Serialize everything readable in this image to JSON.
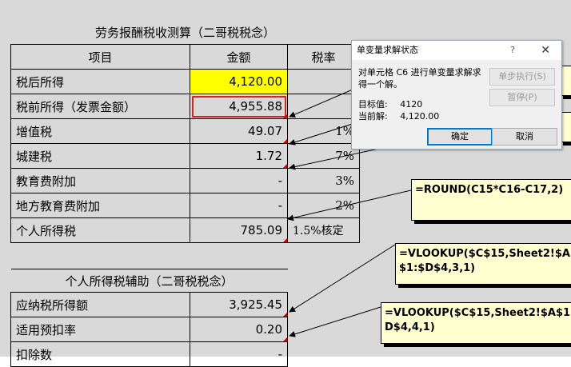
{
  "table1": {
    "title": "劳务报酬税收测算（二哥税税念）",
    "headers": {
      "item": "项目",
      "amount": "金额",
      "rate": "税率"
    },
    "rows": [
      {
        "label": "税后所得",
        "amount": "4,120.00",
        "rate": ""
      },
      {
        "label": "税前所得（发票金额）",
        "amount": "4,955.88",
        "rate": ""
      },
      {
        "label": "增值税",
        "amount": "49.07",
        "rate": "1%"
      },
      {
        "label": "城建税",
        "amount": "1.72",
        "rate": "7%"
      },
      {
        "label": "教育费附加",
        "amount": "-",
        "rate": "3%"
      },
      {
        "label": "地方教育费附加",
        "amount": "-",
        "rate": "2%"
      },
      {
        "label": "个人所得税",
        "amount": "785.09",
        "rate": "1.5%核定"
      }
    ]
  },
  "table2": {
    "title": "个人所得税辅助（二哥税税念）",
    "rows": [
      {
        "label": "应纳税所得额",
        "amount": "3,925.45"
      },
      {
        "label": "适用预扣率",
        "amount": "0.20"
      },
      {
        "label": "扣除数",
        "amount": "-"
      }
    ]
  },
  "notes": {
    "round": "=ROUND(C15*C16-C17,2)",
    "vlookup1_line1": "=VLOOKUP($C$15,Sheet2!$A",
    "vlookup1_line2": "$1:$D$4,3,1)",
    "vlookup2_line1": "=VLOOKUP($C$15,Sheet2!$A$1:$",
    "vlookup2_line2": "D$4,4,1)"
  },
  "dialog": {
    "title": "单变量求解状态",
    "help": "?",
    "message": "对单元格 C6 进行单变量求解求得一个解。",
    "target_label": "目标值:",
    "target_value": "4120",
    "current_label": "当前解:",
    "current_value": "4,120.00",
    "step_button": "单步执行(S)",
    "pause_button": "暂停(P)",
    "ok_button": "确定",
    "cancel_button": "取消"
  },
  "colors": {
    "highlight": "#ffff00",
    "selection_border": "#e02020",
    "comment_bg": "#ffffd0"
  }
}
